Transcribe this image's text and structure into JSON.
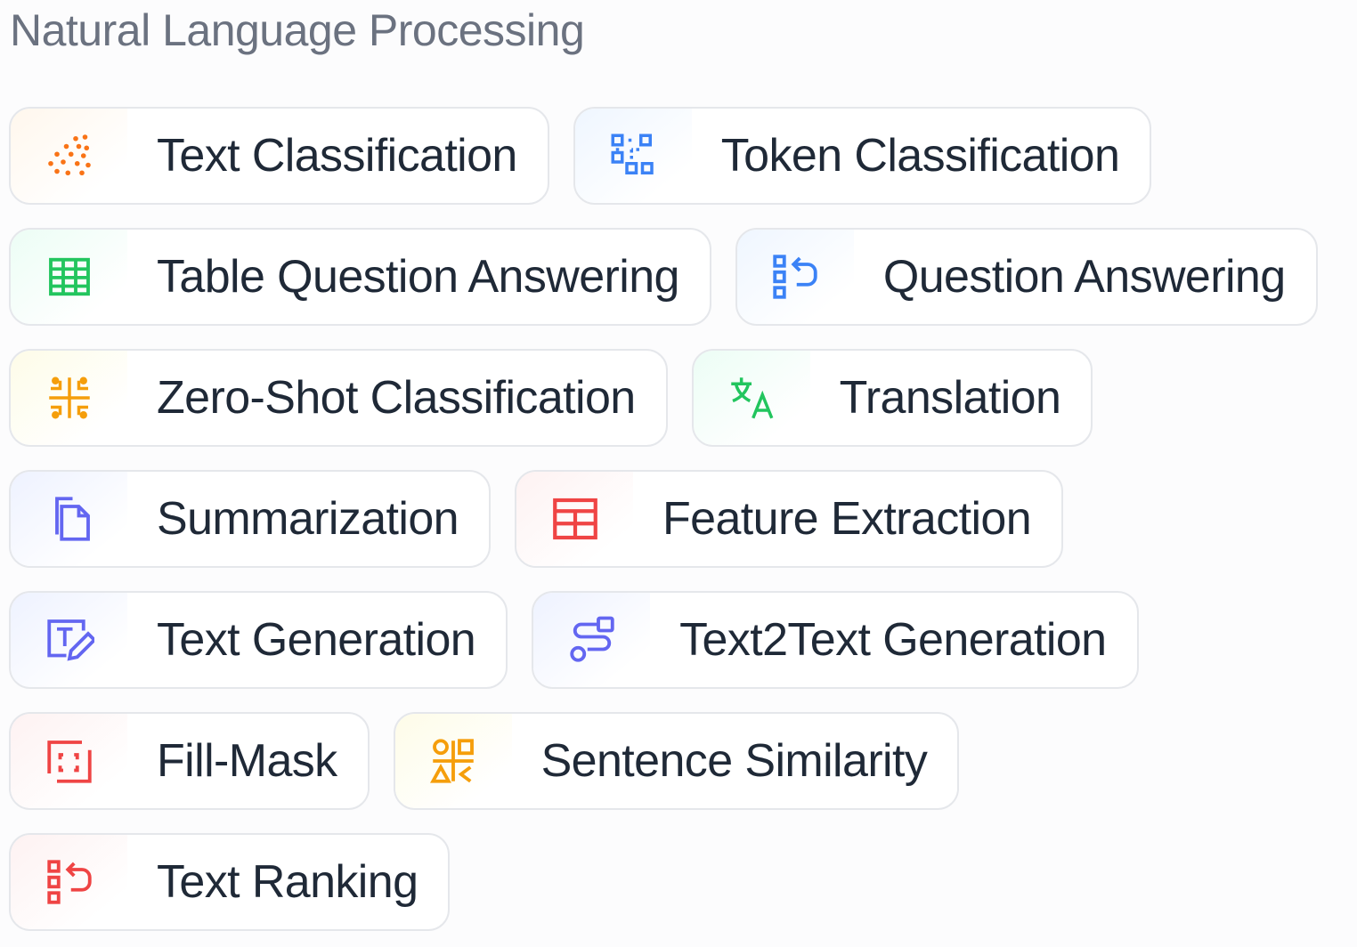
{
  "section": {
    "title": "Natural Language Processing"
  },
  "colors": {
    "orange": "#f97316",
    "blue": "#3b82f6",
    "green": "#22c55e",
    "yellow": "#f59e0b",
    "indigo": "#6366f1",
    "red": "#ef4444",
    "label": "#1f2937",
    "heading": "#6b7280"
  },
  "tasks": [
    {
      "label": "Text Classification",
      "icon": "text-classification-icon",
      "color": "orange"
    },
    {
      "label": "Token Classification",
      "icon": "token-classification-icon",
      "color": "blue"
    },
    {
      "label": "Table Question Answering",
      "icon": "table-icon",
      "color": "green"
    },
    {
      "label": "Question Answering",
      "icon": "question-answering-icon",
      "color": "blue"
    },
    {
      "label": "Zero-Shot Classification",
      "icon": "zero-shot-icon",
      "color": "yellow"
    },
    {
      "label": "Translation",
      "icon": "translation-icon",
      "color": "green"
    },
    {
      "label": "Summarization",
      "icon": "summarization-icon",
      "color": "indigo"
    },
    {
      "label": "Feature Extraction",
      "icon": "feature-extraction-icon",
      "color": "red"
    },
    {
      "label": "Text Generation",
      "icon": "text-generation-icon",
      "color": "indigo"
    },
    {
      "label": "Text2Text Generation",
      "icon": "text2text-icon",
      "color": "indigo"
    },
    {
      "label": "Fill-Mask",
      "icon": "fill-mask-icon",
      "color": "red"
    },
    {
      "label": "Sentence Similarity",
      "icon": "sentence-similarity-icon",
      "color": "yellow"
    },
    {
      "label": "Text Ranking",
      "icon": "text-ranking-icon",
      "color": "red"
    }
  ]
}
